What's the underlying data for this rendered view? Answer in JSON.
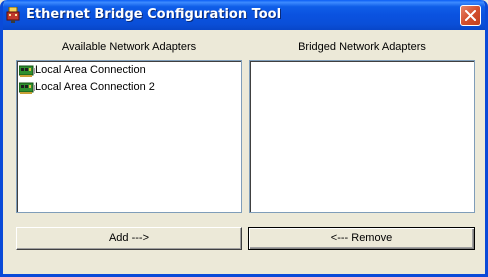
{
  "window": {
    "title": "Ethernet Bridge Configuration Tool",
    "accent": "#0a4ad8"
  },
  "available": {
    "heading": "Available Network Adapters",
    "items": [
      {
        "label": "Local Area Connection",
        "icon": "network-adapter-icon"
      },
      {
        "label": "Local Area Connection 2",
        "icon": "network-adapter-icon"
      }
    ]
  },
  "bridged": {
    "heading": "Bridged Network Adapters",
    "items": []
  },
  "buttons": {
    "add_label": "Add --->",
    "remove_label": "<--- Remove"
  }
}
